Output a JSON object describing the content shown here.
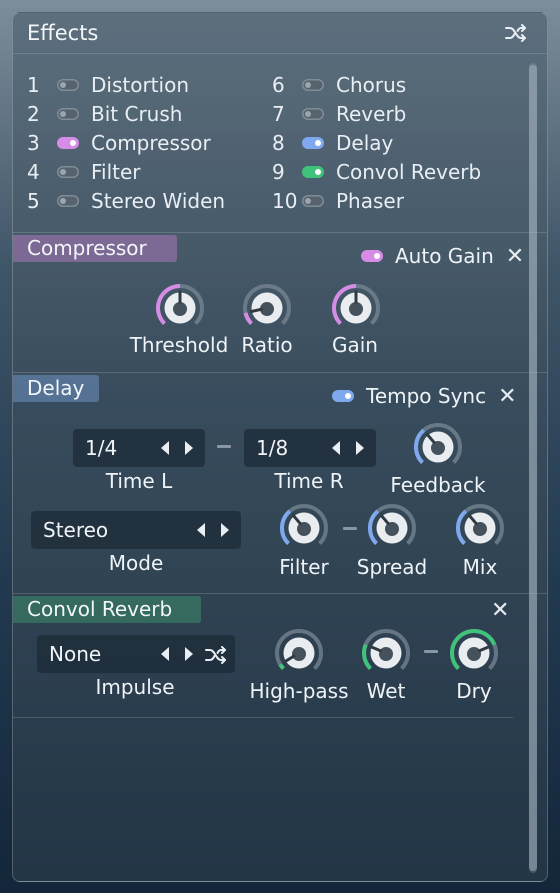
{
  "header": {
    "title": "Effects"
  },
  "effects_list": [
    {
      "num": "1",
      "label": "Distortion",
      "on": false,
      "color": ""
    },
    {
      "num": "2",
      "label": "Bit Crush",
      "on": false,
      "color": ""
    },
    {
      "num": "3",
      "label": "Compressor",
      "on": true,
      "color": "#d68ce6"
    },
    {
      "num": "4",
      "label": "Filter",
      "on": false,
      "color": ""
    },
    {
      "num": "5",
      "label": "Stereo Widen",
      "on": false,
      "color": ""
    },
    {
      "num": "6",
      "label": "Chorus",
      "on": false,
      "color": ""
    },
    {
      "num": "7",
      "label": "Reverb",
      "on": false,
      "color": ""
    },
    {
      "num": "8",
      "label": "Delay",
      "on": true,
      "color": "#7fa8ef"
    },
    {
      "num": "9",
      "label": "Convol Reverb",
      "on": true,
      "color": "#3fc27a"
    },
    {
      "num": "10",
      "label": "Phaser",
      "on": false,
      "color": ""
    }
  ],
  "compressor": {
    "title": "Compressor",
    "color": "#d68ce6",
    "auto_gain_label": "Auto Gain",
    "auto_gain_on": true,
    "knobs": {
      "threshold": {
        "label": "Threshold",
        "value": 0.5
      },
      "ratio": {
        "label": "Ratio",
        "value": 0.12
      },
      "gain": {
        "label": "Gain",
        "value": 0.5
      }
    }
  },
  "delay": {
    "title": "Delay",
    "color": "#7fa8ef",
    "tempo_sync_label": "Tempo Sync",
    "tempo_sync_on": true,
    "time_l": {
      "value": "1/4",
      "label": "Time L"
    },
    "time_r": {
      "value": "1/8",
      "label": "Time R"
    },
    "mode": {
      "value": "Stereo",
      "label": "Mode"
    },
    "knobs": {
      "feedback": {
        "label": "Feedback",
        "value": 0.35
      },
      "filter": {
        "label": "Filter",
        "value": 0.35
      },
      "spread": {
        "label": "Spread",
        "value": 0.35
      },
      "mix": {
        "label": "Mix",
        "value": 0.35
      }
    }
  },
  "convol_reverb": {
    "title": "Convol Reverb",
    "color": "#3fc27a",
    "impulse": {
      "value": "None",
      "label": "Impulse"
    },
    "knobs": {
      "highpass": {
        "label": "High-pass",
        "value": 0.05
      },
      "wet": {
        "label": "Wet",
        "value": 0.25
      },
      "dry": {
        "label": "Dry",
        "value": 0.75
      }
    }
  },
  "icons": {
    "shuffle": "shuffle-icon",
    "close": "close-icon",
    "arrow_left": "arrow-left-icon",
    "arrow_right": "arrow-right-icon"
  }
}
